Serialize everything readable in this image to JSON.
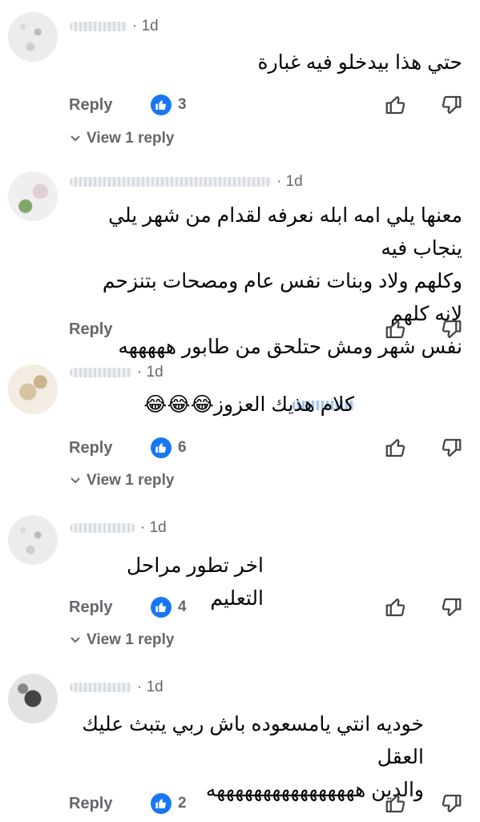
{
  "comments": [
    {
      "time": "· 1d",
      "text_lines": [
        "حتي هذا بيدخلو فيه غبارة"
      ],
      "reply_label": "Reply",
      "like_count": "3",
      "view_replies": "View 1 reply"
    },
    {
      "time": "· 1d",
      "text_lines": [
        "معنها يلي امه ابله نعرفه لقدام من شهر يلي ينجاب فيه",
        "وكلهم ولاد وبنات نفس عام ومصحات بتنزحم لانه كلهم",
        "نفس شهر ومش حتلحق من طابور هههههه"
      ],
      "reply_label": "Reply"
    },
    {
      "time": "· 1d",
      "text_lines": [
        "كلام هذيك العزوز😂😂😂"
      ],
      "reply_label": "Reply",
      "like_count": "6",
      "view_replies": "View 1 reply"
    },
    {
      "time": "· 1d",
      "text_lines": [
        "اخر تطور مراحل التعليم"
      ],
      "reply_label": "Reply",
      "like_count": "4",
      "view_replies": "View 1 reply"
    },
    {
      "time": "· 1d",
      "text_lines": [
        "خوديه انتي يامسعوده باش ربي يتبث عليك العقل",
        "والدين ههههههههههههههههه"
      ],
      "reply_label": "Reply",
      "like_count": "2"
    }
  ],
  "icons": {
    "like_badge": "thumb-up-icon",
    "like_action": "thumb-up-outline-icon",
    "dislike_action": "thumb-down-outline-icon",
    "expand": "chevron-down-icon"
  },
  "colors": {
    "accent": "#1877f2",
    "secondary_text": "#65676b",
    "primary_text": "#050505"
  }
}
